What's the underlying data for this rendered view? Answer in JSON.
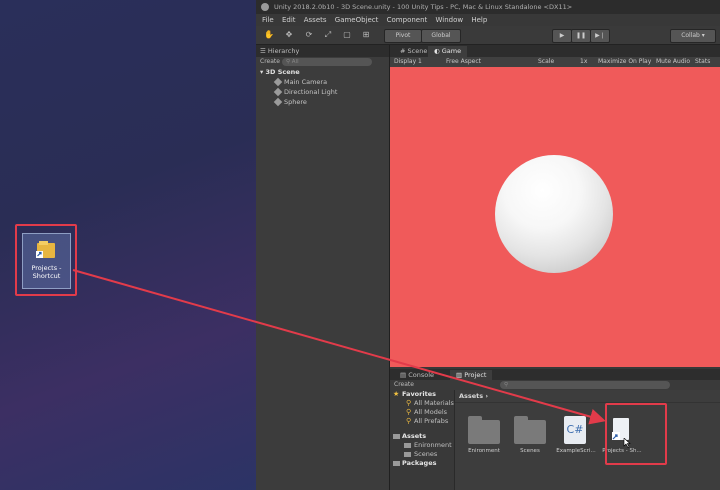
{
  "desktop": {
    "shortcut_label": "Projects - Shortcut"
  },
  "window": {
    "title": "Unity 2018.2.0b10 - 3D Scene.unity - 100 Unity Tips - PC, Mac & Linux Standalone <DX11>",
    "menu": [
      "File",
      "Edit",
      "Assets",
      "GameObject",
      "Component",
      "Window",
      "Help"
    ]
  },
  "toolbar": {
    "pivot_label": "Pivot",
    "global_label": "Global",
    "collab_label": "Collab"
  },
  "hierarchy": {
    "tab_label": "Hierarchy",
    "create_label": "Create",
    "search_placeholder": "All",
    "scene_name": "3D Scene",
    "items": [
      "Main Camera",
      "Directional Light",
      "Sphere"
    ]
  },
  "view": {
    "scene_tab": "Scene",
    "game_tab": "Game",
    "display": "Display 1",
    "aspect": "Free Aspect",
    "scale_label": "Scale",
    "scale_value": "1x",
    "maximize": "Maximize On Play",
    "mute": "Mute Audio",
    "stats": "Stats",
    "background_color": "#f05a5a"
  },
  "bottom": {
    "console_tab": "Console",
    "project_tab": "Project",
    "create_label": "Create",
    "favorites_label": "Favorites",
    "favorites": [
      "All Materials",
      "All Models",
      "All Prefabs"
    ],
    "assets_label": "Assets",
    "asset_children": [
      "Enironment",
      "Scenes"
    ],
    "packages_label": "Packages",
    "breadcrumb": "Assets",
    "asset_items": [
      {
        "label": "Enironment",
        "icon": "folder-icon"
      },
      {
        "label": "Scenes",
        "icon": "folder-icon"
      },
      {
        "label": "ExampleScri...",
        "icon": "csharp-script-icon"
      },
      {
        "label": "Projects - Sh...",
        "icon": "shortcut-file-icon"
      }
    ]
  },
  "annotation_color": "#e23b4a"
}
